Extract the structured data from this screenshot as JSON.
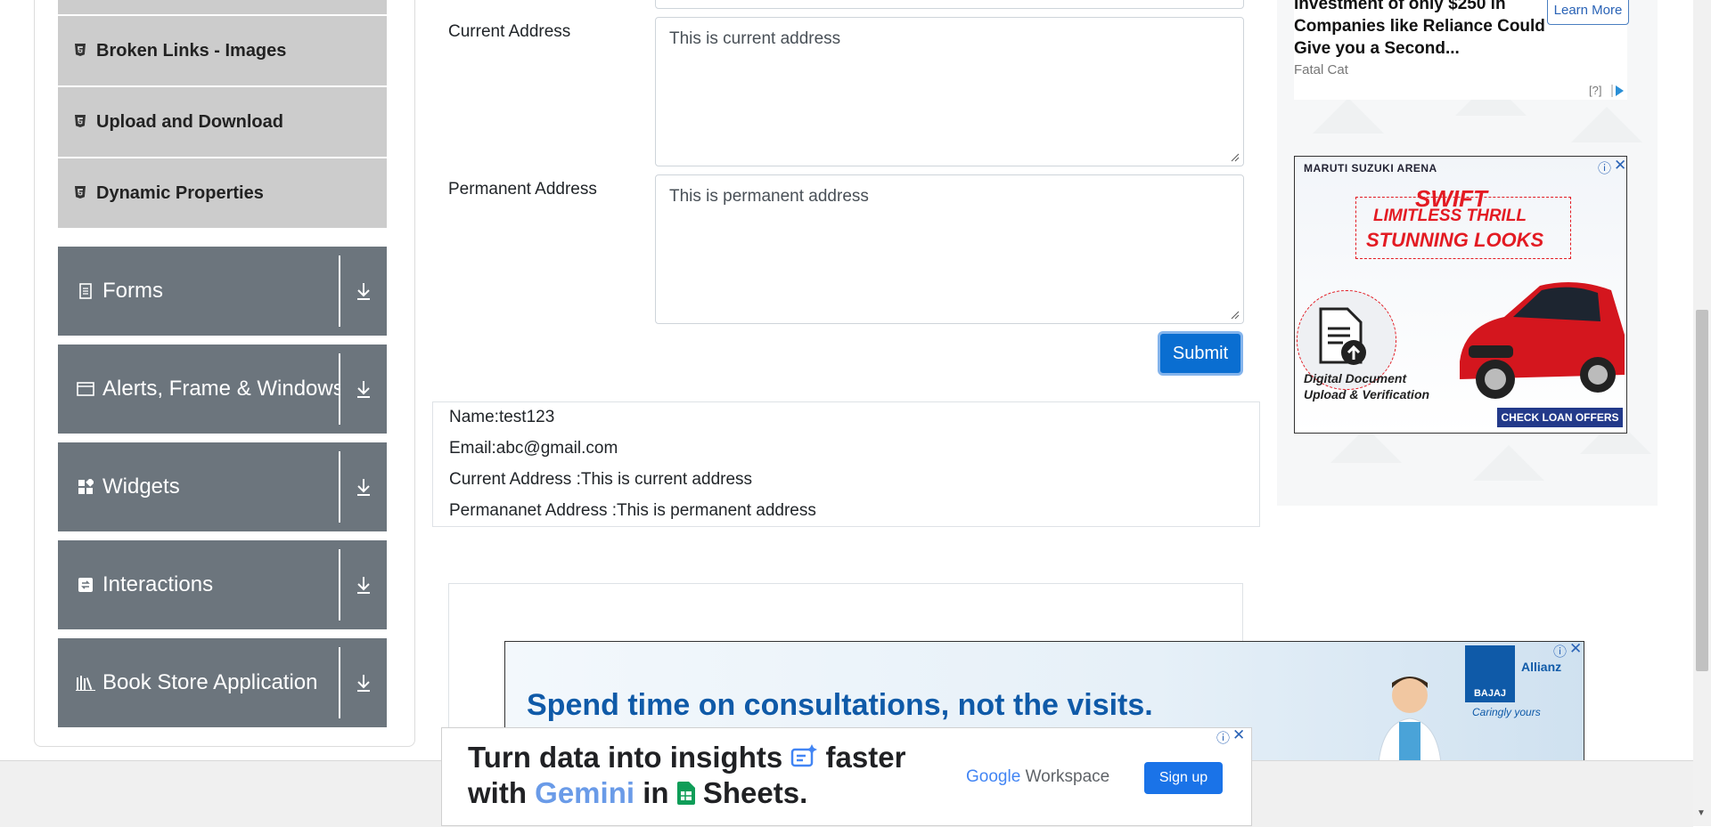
{
  "sidebar": {
    "sub_items": [
      {
        "label": "Broken Links - Images",
        "icon": "html5-icon"
      },
      {
        "label": "Upload and Download",
        "icon": "html5-icon"
      },
      {
        "label": "Dynamic Properties",
        "icon": "html5-icon"
      }
    ],
    "groups": [
      {
        "label": "Forms",
        "icon": "document-icon"
      },
      {
        "label": "Alerts, Frame & Windows",
        "icon": "window-icon"
      },
      {
        "label": "Widgets",
        "icon": "widgets-icon"
      },
      {
        "label": "Interactions",
        "icon": "interactions-icon"
      },
      {
        "label": "Book Store Application",
        "icon": "books-icon"
      }
    ]
  },
  "form": {
    "current_address_label": "Current Address",
    "current_address_value": "This is current address",
    "permanent_address_label": "Permanent Address",
    "permanent_address_value": "This is permanent address",
    "submit_label": "Submit"
  },
  "output": {
    "name": "Name:test123",
    "email": "Email:abc@gmail.com",
    "current_address": "Current Address :This is current address",
    "permanent_address": "Permananet Address :This is permanent address"
  },
  "ads": {
    "right_top": {
      "headline": "Investment of only $250 in Companies like Reliance Could Give you a Second...",
      "source": "Fatal Cat",
      "cta": "Learn More",
      "help": "[?]"
    },
    "right_car": {
      "brand": "MARUTI SUZUKI ARENA",
      "model": "SWIFT",
      "tagline1": "LIMITLESS THRILL",
      "tagline2": "STUNNING LOOKS",
      "doc_text": "Digital Document Upload & Verification",
      "cta": "CHECK LOAN OFFERS"
    },
    "middle": {
      "headline": "Spend time on consultations, not the visits.",
      "brand": "BAJAJ",
      "partner": "Allianz",
      "slogan": "Caringly yours"
    },
    "bottom": {
      "line1": "Turn data into insights",
      "line1_end": "faster",
      "line2_a": "with",
      "line2_gemini": "Gemini",
      "line2_b": "in",
      "line2_sheets": "Sheets.",
      "brand_google": "Google",
      "brand_workspace": "Workspace",
      "cta": "Sign up"
    }
  },
  "colors": {
    "sidebar_group_bg": "#6c757d",
    "sidebar_sub_bg": "#cccccc",
    "submit_bg": "#0a6ed1",
    "ad_link": "#2a63b6"
  }
}
